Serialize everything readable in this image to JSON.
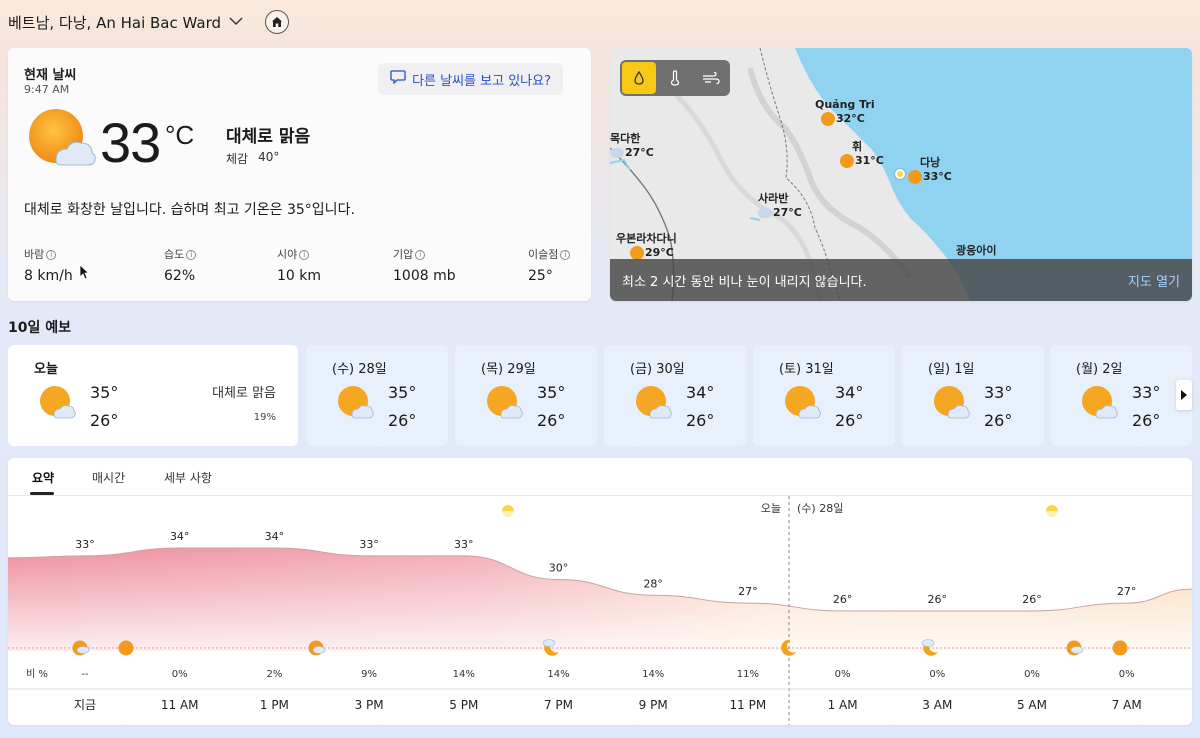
{
  "location": {
    "title": "베트남, 다낭, An Hai Bac Ward"
  },
  "current": {
    "title": "현재 날씨",
    "time": "9:47 AM",
    "ask": "다른 날씨를 보고 있나요?",
    "temp": "33",
    "unit": "°C",
    "condition": "대체로 맑음",
    "feels_label": "체감",
    "feels_value": "40°",
    "description": "대체로 화창한 날입니다. 습하며 최고 기온은 35°입니다.",
    "stats": [
      {
        "label": "바람",
        "value": "8 km/h"
      },
      {
        "label": "습도",
        "value": "62%"
      },
      {
        "label": "시야",
        "value": "10 km"
      },
      {
        "label": "기압",
        "value": "1008 mb"
      },
      {
        "label": "이슬점",
        "value": "25°"
      }
    ]
  },
  "map": {
    "cities": [
      {
        "name": "Quảng Tri",
        "temp": "32°C"
      },
      {
        "name": "휘",
        "temp": "31°C"
      },
      {
        "name": "다낭",
        "temp": "33°C"
      },
      {
        "name": "목다한",
        "temp": "27°C"
      },
      {
        "name": "사라반",
        "temp": "27°C"
      },
      {
        "name": "우본라차다니",
        "temp": "29°C"
      },
      {
        "name": "광응아이",
        "temp": ""
      }
    ],
    "footer_text": "최소 2 시간 동안 비나 눈이 내리지 않습니다.",
    "open_label": "지도 열기"
  },
  "forecast": {
    "title": "10일 예보",
    "days": [
      {
        "label": "오늘",
        "hi": "35°",
        "lo": "26°",
        "cond": "대체로 맑음",
        "pct": "19%"
      },
      {
        "label": "(수) 28일",
        "hi": "35°",
        "lo": "26°"
      },
      {
        "label": "(목) 29일",
        "hi": "35°",
        "lo": "26°"
      },
      {
        "label": "(금) 30일",
        "hi": "34°",
        "lo": "26°"
      },
      {
        "label": "(토) 31일",
        "hi": "34°",
        "lo": "26°"
      },
      {
        "label": "(일) 1일",
        "hi": "33°",
        "lo": "26°"
      },
      {
        "label": "(월) 2일",
        "hi": "33°",
        "lo": "26°"
      }
    ]
  },
  "detail": {
    "tabs": [
      "요약",
      "매시간",
      "세부 사항"
    ],
    "today_label": "오늘",
    "next_label": "(수) 28일",
    "rain_label": "비 %"
  },
  "chart_data": {
    "type": "area",
    "x": [
      "지금",
      "11 AM",
      "1 PM",
      "3 PM",
      "5 PM",
      "7 PM",
      "9 PM",
      "11 PM",
      "1 AM",
      "3 AM",
      "5 AM",
      "7 AM"
    ],
    "temps": [
      33,
      34,
      34,
      33,
      33,
      30,
      28,
      27,
      26,
      26,
      26,
      27
    ],
    "temp_labels": [
      "33°",
      "34°",
      "34°",
      "33°",
      "33°",
      "30°",
      "28°",
      "27°",
      "26°",
      "26°",
      "26°",
      "27°"
    ],
    "precip": [
      "--",
      "0%",
      "2%",
      "9%",
      "14%",
      "14%",
      "14%",
      "11%",
      "0%",
      "0%",
      "0%",
      "0%"
    ],
    "hot_color": "#e96a7e",
    "mild_color": "#f7c89a"
  }
}
